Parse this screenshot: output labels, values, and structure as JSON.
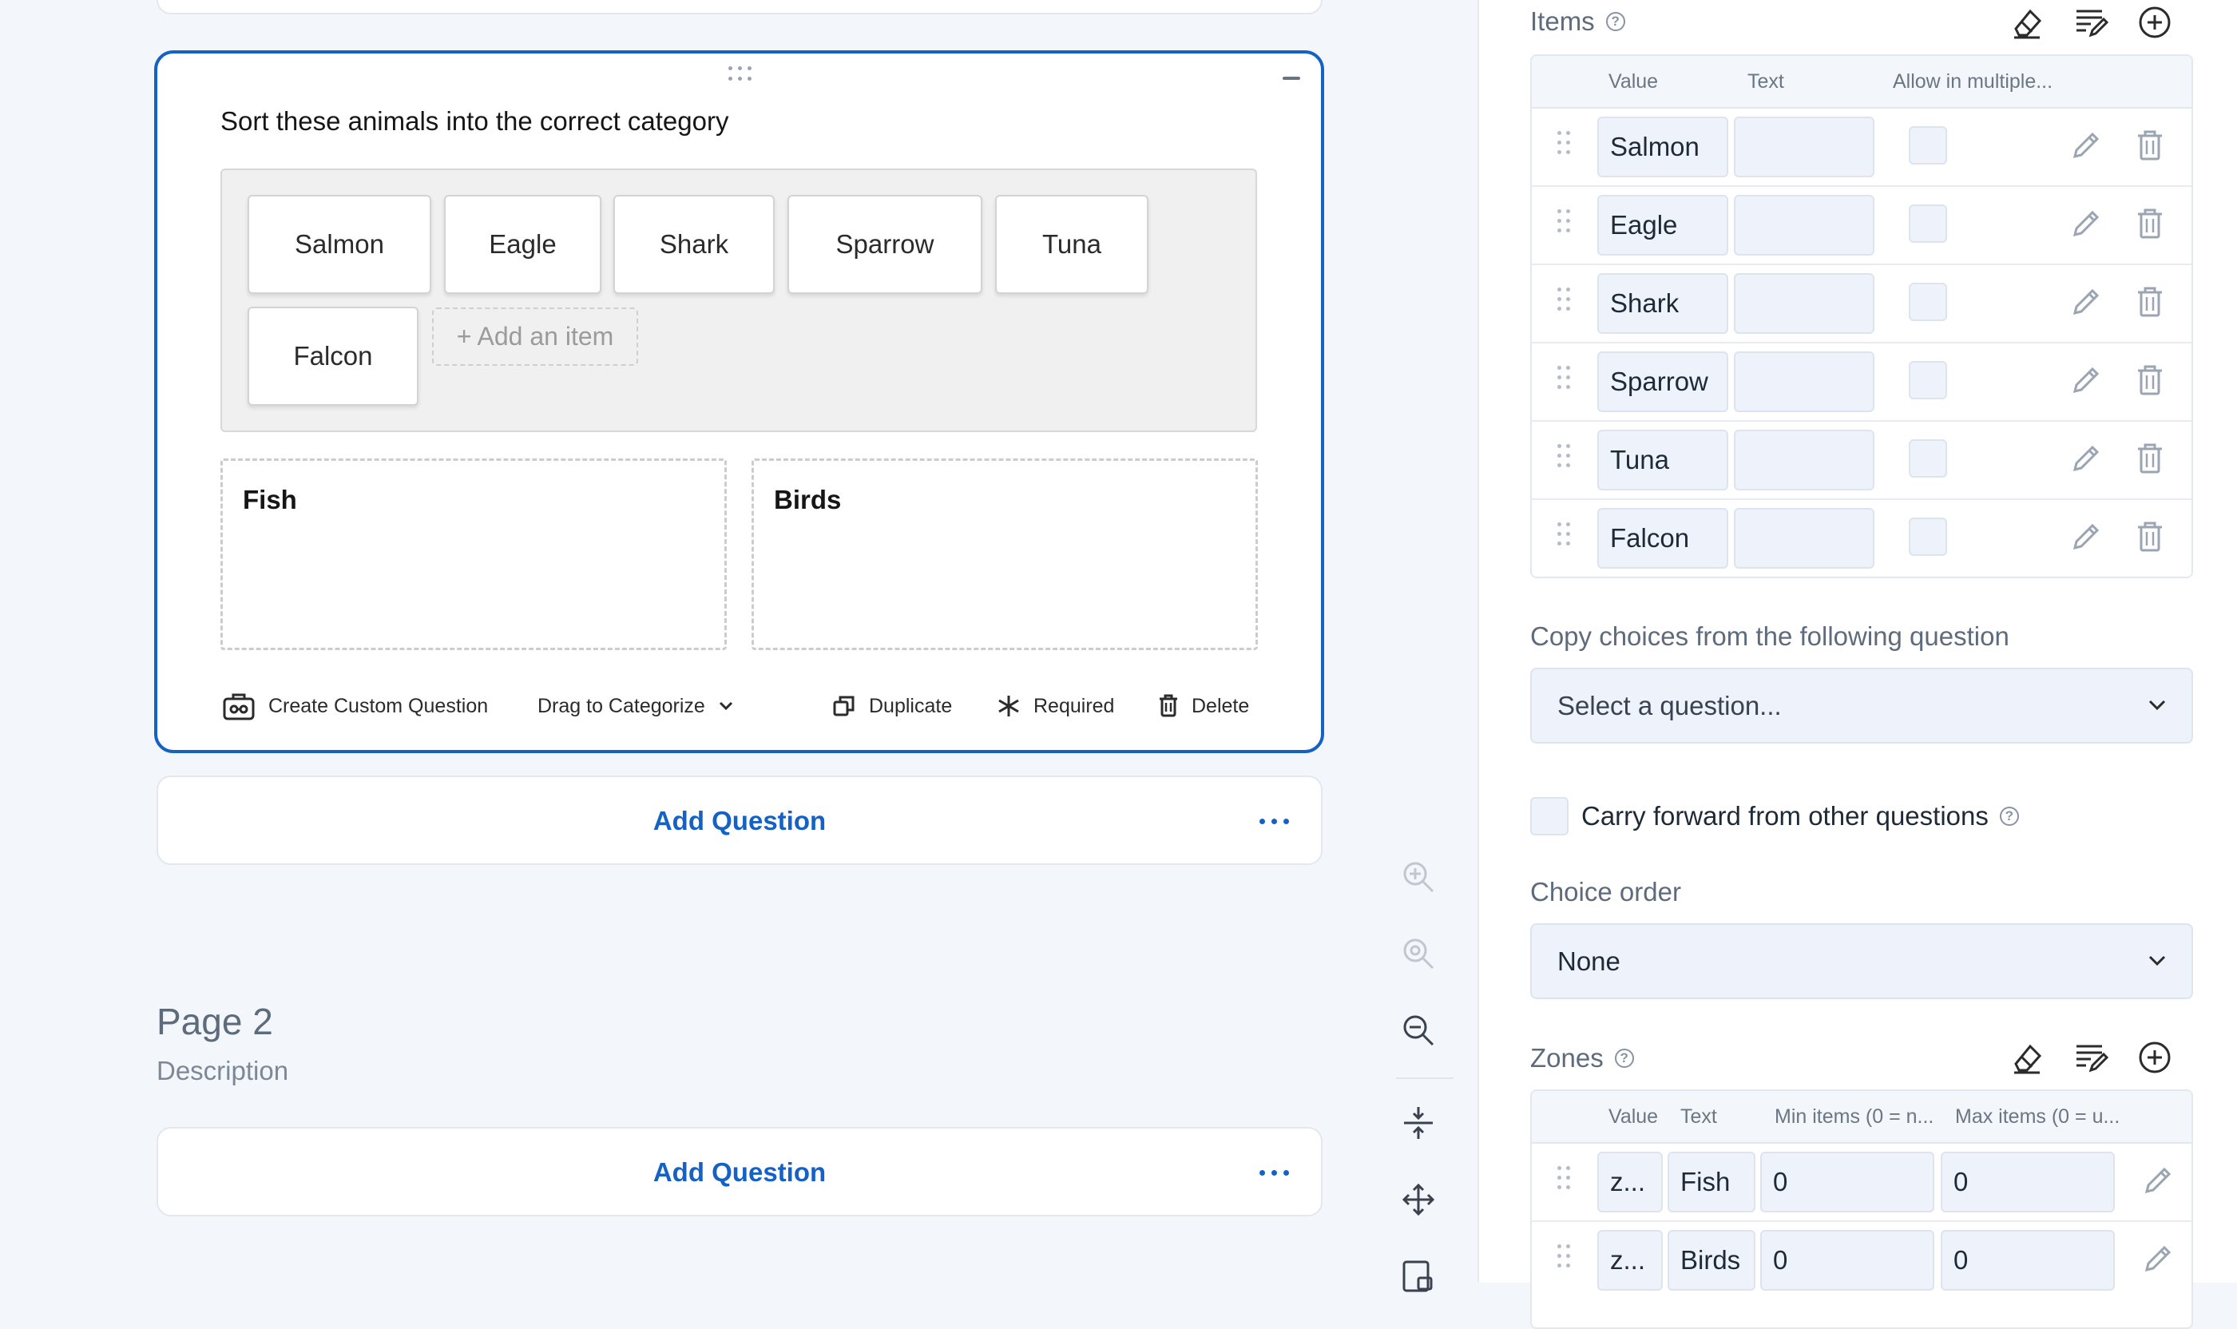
{
  "question": {
    "title": "Sort these animals into the correct category",
    "pool_items": [
      "Salmon",
      "Eagle",
      "Shark",
      "Sparrow",
      "Tuna",
      "Falcon"
    ],
    "add_item_label": "+ Add an item",
    "zones": [
      "Fish",
      "Birds"
    ],
    "footer": {
      "create_custom": "Create Custom Question",
      "type_select": "Drag to Categorize",
      "duplicate": "Duplicate",
      "required": "Required",
      "delete": "Delete"
    }
  },
  "add_question_label": "Add Question",
  "page2": {
    "title": "Page 2",
    "description": "Description"
  },
  "panel": {
    "items_title": "Items",
    "items_columns": [
      "Value",
      "Text",
      "Allow in multiple..."
    ],
    "items": [
      {
        "value": "Salmon",
        "text": ""
      },
      {
        "value": "Eagle",
        "text": ""
      },
      {
        "value": "Shark",
        "text": ""
      },
      {
        "value": "Sparrow",
        "text": ""
      },
      {
        "value": "Tuna",
        "text": ""
      },
      {
        "value": "Falcon",
        "text": ""
      }
    ],
    "copy_choices_label": "Copy choices from the following question",
    "copy_choices_placeholder": "Select a question...",
    "carry_forward_label": "Carry forward from other questions",
    "choice_order_label": "Choice order",
    "choice_order_value": "None",
    "zones_title": "Zones",
    "zones_columns": [
      "Value",
      "Text",
      "Min items (0 = n...",
      "Max items (0 = u..."
    ],
    "zones": [
      {
        "value": "z...",
        "text": "Fish",
        "min": "0",
        "max": "0"
      },
      {
        "value": "z...",
        "text": "Birds",
        "min": "0",
        "max": "0"
      }
    ]
  },
  "colors": {
    "accent": "#1561c4",
    "canvas_bg": "#f3f6fa",
    "input_bg": "#eef3fb"
  }
}
